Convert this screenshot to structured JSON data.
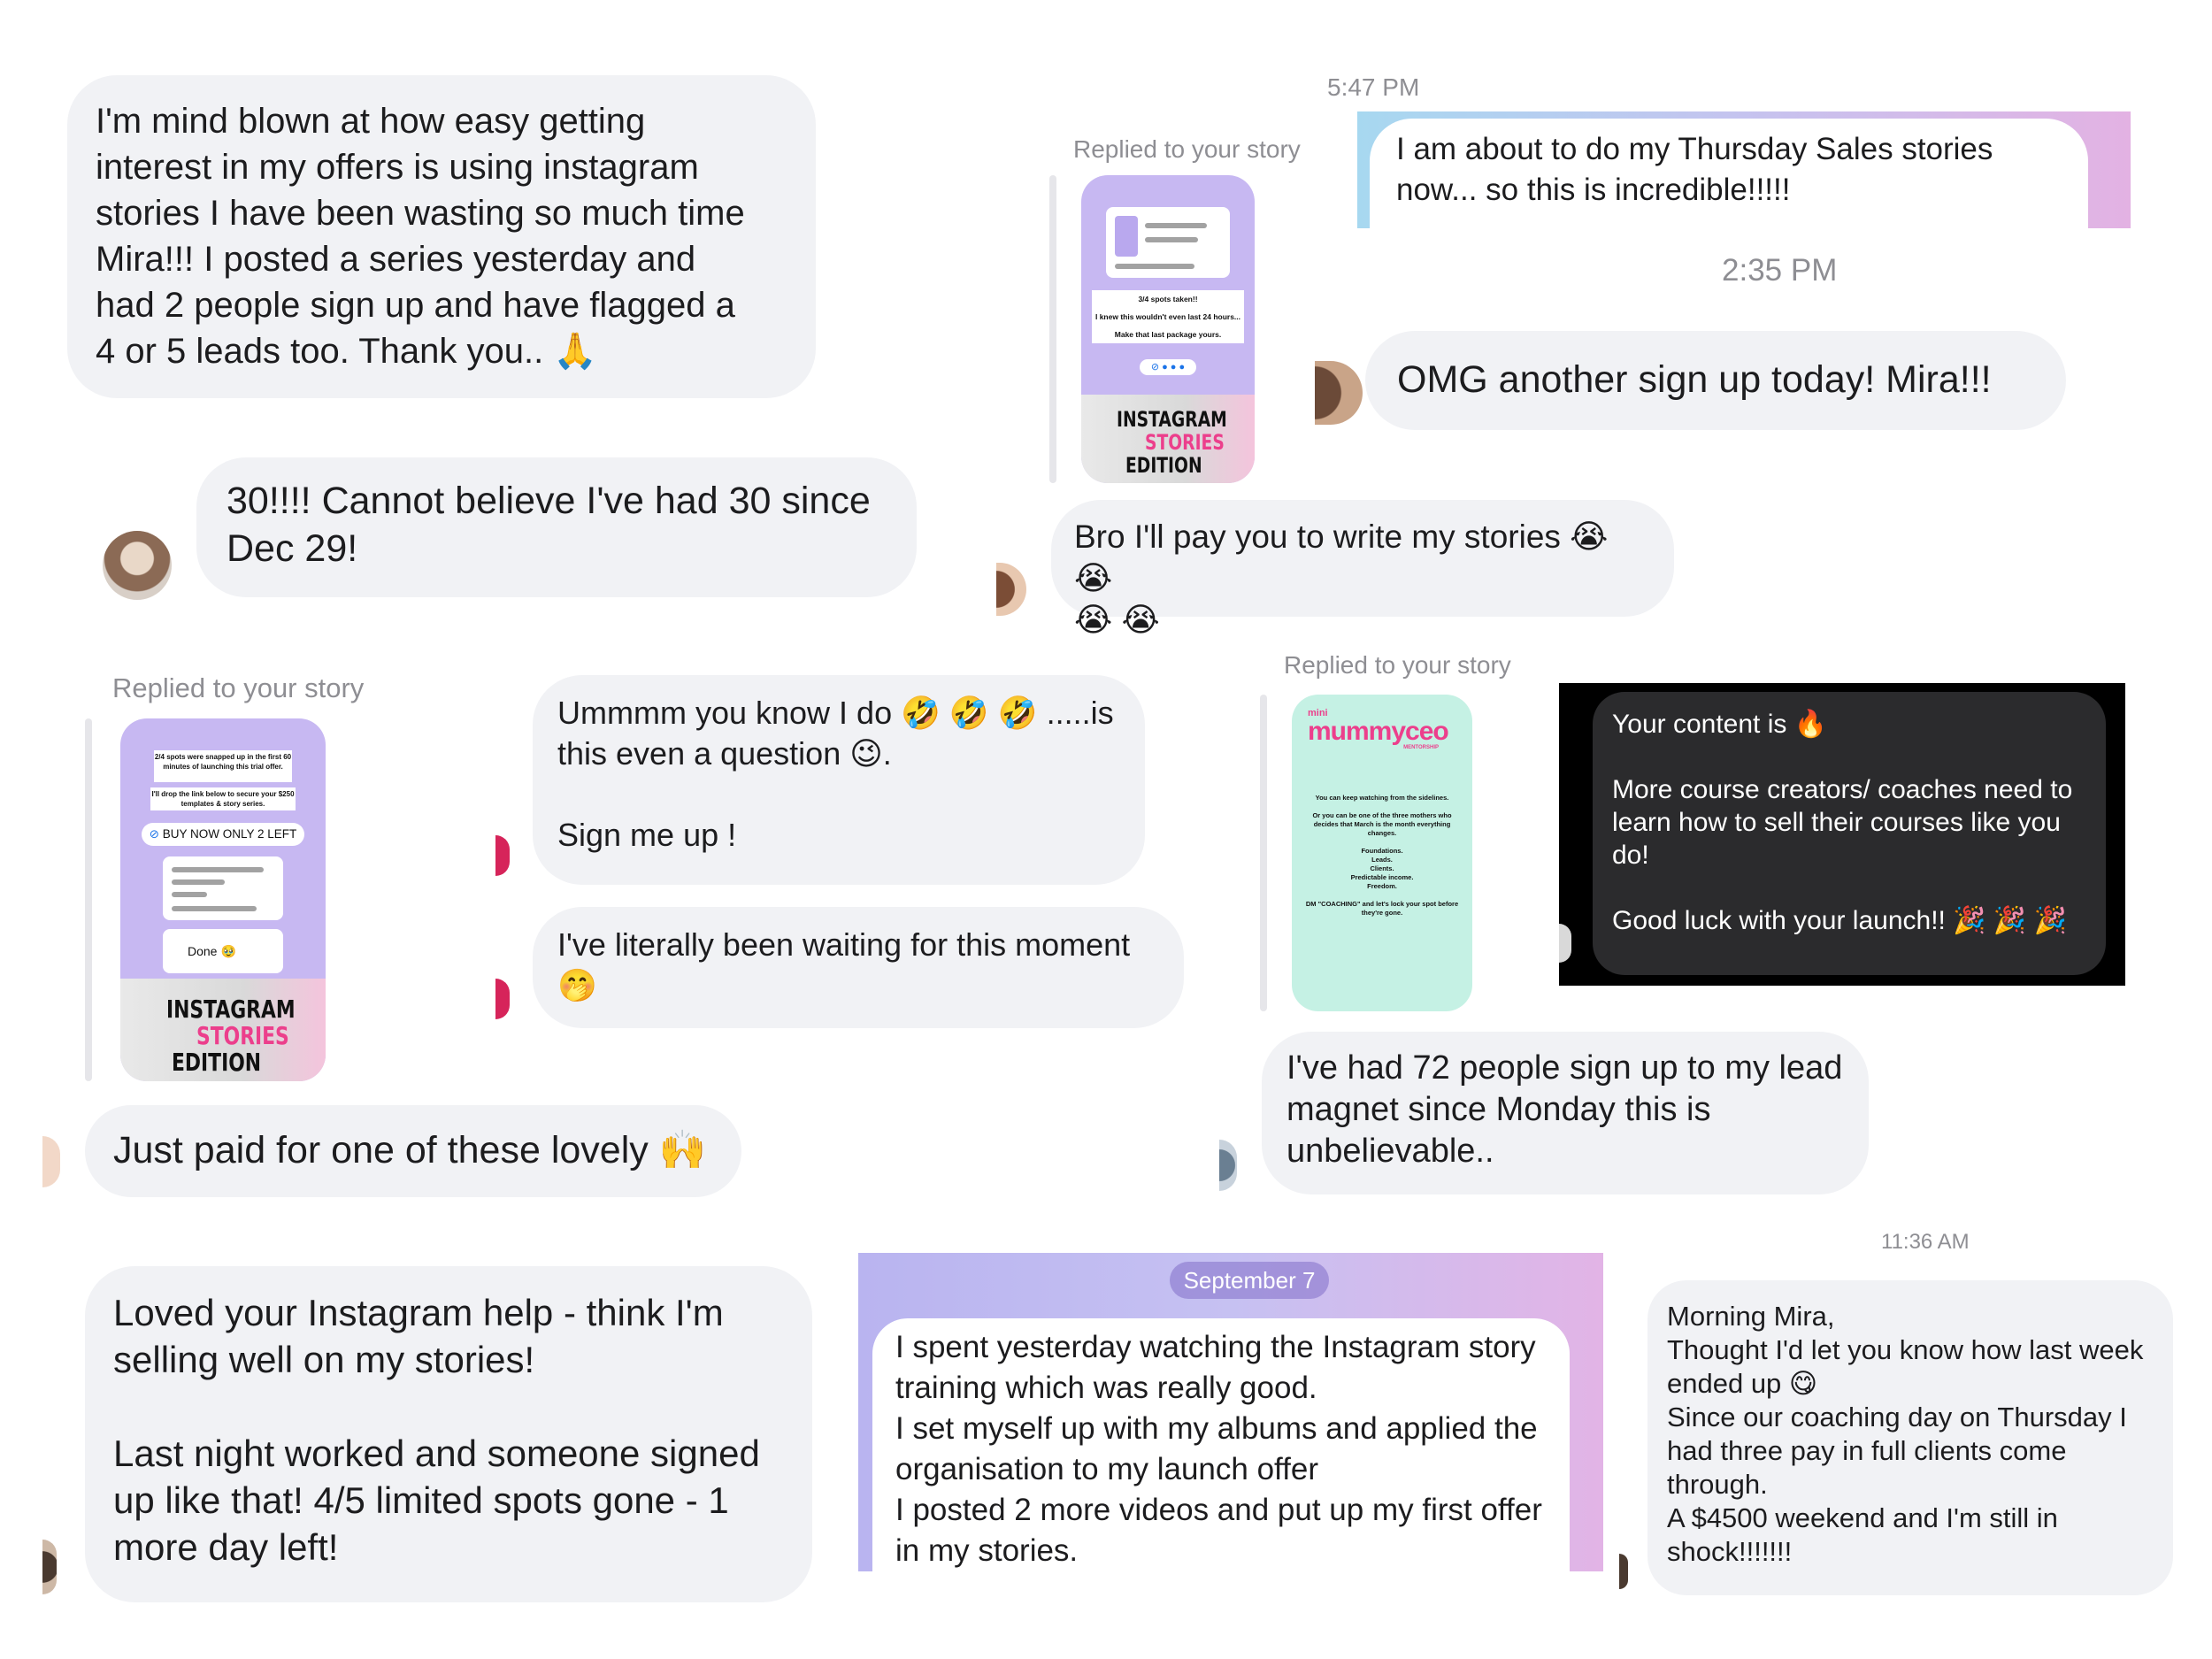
{
  "colors": {
    "bubble_bg": "#f1f2f5",
    "story_purple": "#c7b8f2",
    "story_mint": "#c5f1e4",
    "brand_pink": "#ec3f8c",
    "dark_card": "#2b2b2d"
  },
  "panel1": {
    "message": "I'm mind blown at how easy getting\ninterest in my offers is using instagram\nstories I have been wasting so much time\nMira!!! I posted a series yesterday and\nhad 2 people sign up and have flagged a\n4 or 5 leads too. Thank you.. 🙏"
  },
  "panel2": {
    "message": "30!!!! Cannot believe I've had 30 since\nDec 29!"
  },
  "panel3": {
    "replied_label": "Replied to your story",
    "story_lines": [
      "3/4 spots taken!!",
      "I knew this wouldn't even last 24 hours...",
      "Make that last package yours."
    ],
    "story_cover_1": "INSTAGRAM",
    "story_cover_2": "STORIES",
    "story_cover_3": "EDITION",
    "message": "Bro I'll pay you to write my stories 😭 😭\n😭 😭"
  },
  "panel4": {
    "time_1": "5:47 PM",
    "message_1": "I am about to do my Thursday Sales stories\nnow... so this is incredible!!!!!",
    "time_2": "2:35 PM",
    "message_2": "OMG another sign up today! Mira!!!"
  },
  "panel5": {
    "replied_label": "Replied to your story",
    "story_lines": [
      "2/4 spots were snapped up in the first 60 minutes of launching this trial offer.",
      "I'll drop the link below to secure your $250 templates & story series."
    ],
    "story_button": "BUY NOW ONLY 2 LEFT",
    "story_done": "Done",
    "story_cover_1": "INSTAGRAM",
    "story_cover_2": "STORIES",
    "story_cover_3": "EDITION",
    "message": "Just paid for one of these lovely 🙌"
  },
  "panel6": {
    "message_1": "Ummmm you know I do 🤣 🤣 🤣 .....is\nthis even a question 😉.\n\nSign me up !",
    "message_2": "I've literally been waiting for this moment\n🤭"
  },
  "panel7": {
    "replied_label": "Replied to your story",
    "story_brand_small": "mini",
    "story_brand": "mummyceo",
    "story_brand_sub": "MENTORSHIP",
    "story_lines": [
      "You can keep watching from the sidelines.",
      "Or you can be one of the three mothers who decides that March is the month everything changes.",
      "Foundations.",
      "Leads.",
      "Clients.",
      "Predictable income.",
      "Freedom.",
      "DM \"COACHING\" and let's lock your spot before they're gone."
    ],
    "message": "I've had 72 people sign up to my lead\nmagnet since Monday this is\nunbelievable.."
  },
  "panel8": {
    "message": "Your content is 🔥\n\nMore course creators/ coaches need to\nlearn how to sell their courses like you\ndo!\n\nGood luck with your launch!! 🎉 🎉 🎉"
  },
  "panel9": {
    "message": "Loved your Instagram help - think I'm\nselling well on my stories!\n\nLast night worked and someone signed\nup like that! 4/5 limited spots gone - 1\nmore day left!"
  },
  "panel10": {
    "date_pill": "September 7",
    "message": "I spent yesterday watching the Instagram story\ntraining which was really good.\nI set myself up with my albums and applied the\norganisation to my launch offer\nI posted 2 more videos and put up my first offer\nin my stories."
  },
  "panel11": {
    "time": "11:36 AM",
    "message": "Morning Mira,\nThought I'd let you know how last week\nended up 😋\nSince our coaching day on Thursday I\nhad three pay in full clients come\nthrough.\nA $4500 weekend and I'm still in\nshock!!!!!!!"
  }
}
